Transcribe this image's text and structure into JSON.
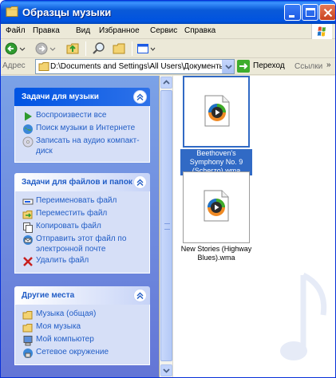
{
  "window": {
    "title": "Образцы музыки"
  },
  "menu": {
    "items": [
      "Файл",
      "Правка",
      "Вид",
      "Избранное",
      "Сервис",
      "Справка"
    ]
  },
  "toolbar": {
    "buttons": [
      "back-icon",
      "forward-icon",
      "up-folder-icon",
      "search-icon",
      "folders-icon",
      "views-icon"
    ]
  },
  "address": {
    "label": "Адрес",
    "path": "D:\\Documents and Settings\\All Users\\Документы\\Мо",
    "go_label": "Переход",
    "links_label": "Ссылки"
  },
  "panels": {
    "music_tasks": {
      "title": "Задачи для музыки",
      "items": [
        {
          "label": "Воспроизвести все",
          "icon": "play-icon"
        },
        {
          "label": "Поиск музыки в Интернете",
          "icon": "globe-icon"
        },
        {
          "label": "Записать на аудио компакт-диск",
          "icon": "cd-icon"
        }
      ]
    },
    "file_tasks": {
      "title": "Задачи для файлов и папок",
      "items": [
        {
          "label": "Переименовать файл",
          "icon": "rename-icon"
        },
        {
          "label": "Переместить файл",
          "icon": "move-icon"
        },
        {
          "label": "Копировать файл",
          "icon": "copy-icon"
        },
        {
          "label": "Отправить этот файл по электронной почте",
          "icon": "email-icon"
        },
        {
          "label": "Удалить файл",
          "icon": "delete-icon"
        }
      ]
    },
    "other_places": {
      "title": "Другие места",
      "items": [
        {
          "label": "Музыка (общая)",
          "icon": "folder-icon"
        },
        {
          "label": "Моя музыка",
          "icon": "folder-icon"
        },
        {
          "label": "Мой компьютер",
          "icon": "computer-icon"
        },
        {
          "label": "Сетевое окружение",
          "icon": "network-icon"
        }
      ]
    }
  },
  "files": [
    {
      "name": "Beethoven's Symphony No. 9 (Scherzo).wma",
      "selected": true
    },
    {
      "name": "New Stories (Highway Blues).wma",
      "selected": false
    }
  ],
  "colors": {
    "title_bar": "#0054E3",
    "task_pane": "#6375D6",
    "link": "#215DC6",
    "selection": "#316AC5"
  }
}
